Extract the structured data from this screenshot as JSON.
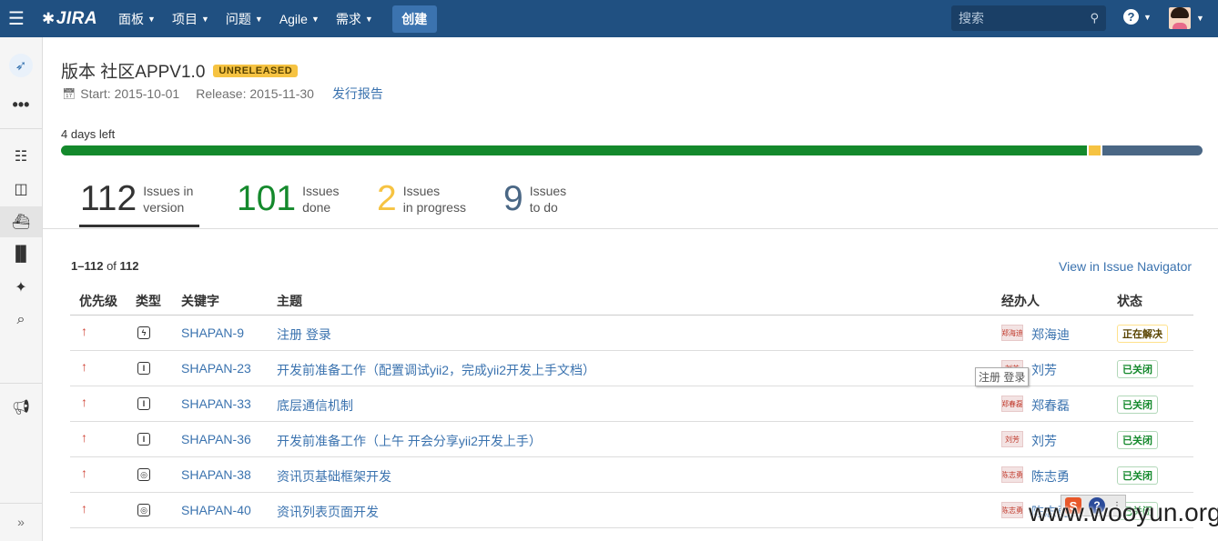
{
  "nav": {
    "logo": "JIRA",
    "items": [
      "面板",
      "项目",
      "问题",
      "Agile",
      "需求"
    ],
    "create_label": "创建",
    "search_placeholder": "搜索"
  },
  "version": {
    "title": "版本 社区APPV1.0",
    "badge": "UNRELEASED",
    "start": "Start: 2015-10-01",
    "release": "Release: 2015-11-30",
    "report_link": "发行报告",
    "days_left": "4 days left",
    "progress": {
      "done": 101,
      "in_progress": 2,
      "todo": 9,
      "total": 112,
      "colors": {
        "done": "#14892c",
        "in_progress": "#f6c342",
        "todo": "#4a6785"
      }
    }
  },
  "stats": [
    {
      "num": "112",
      "line1": "Issues in",
      "line2": "version",
      "color": "#333333"
    },
    {
      "num": "101",
      "line1": "Issues",
      "line2": "done",
      "color": "#14892c"
    },
    {
      "num": "2",
      "line1": "Issues",
      "line2": "in progress",
      "color": "#f6c342"
    },
    {
      "num": "9",
      "line1": "Issues",
      "line2": "to do",
      "color": "#4a6785"
    }
  ],
  "list": {
    "range": "1–112",
    "of": "of",
    "total": "112",
    "navigator_link": "View in Issue Navigator"
  },
  "table": {
    "headers": {
      "priority": "优先级",
      "type": "类型",
      "key": "关键字",
      "summary": "主题",
      "assignee": "经办人",
      "status": "状态"
    },
    "rows": [
      {
        "priority": "↑",
        "type_icon": "ϟ",
        "key": "SHAPAN-9",
        "summary": "注册 登录",
        "assignee_img": "郑海迪",
        "assignee": "郑海迪",
        "status": "正在解决",
        "status_kind": "inprog"
      },
      {
        "priority": "↑",
        "type_icon": "I",
        "key": "SHAPAN-23",
        "summary": "开发前准备工作（配置调试yii2，完成yii2开发上手文档）",
        "assignee_img": "刘芳",
        "assignee": "刘芳",
        "status": "已关闭",
        "status_kind": "closed"
      },
      {
        "priority": "↑",
        "type_icon": "I",
        "key": "SHAPAN-33",
        "summary": "底层通信机制",
        "assignee_img": "郑春磊",
        "assignee": "郑春磊",
        "status": "已关闭",
        "status_kind": "closed"
      },
      {
        "priority": "↑",
        "type_icon": "I",
        "key": "SHAPAN-36",
        "summary": "开发前准备工作（上午 开会分享yii2开发上手）",
        "assignee_img": "刘芳",
        "assignee": "刘芳",
        "status": "已关闭",
        "status_kind": "closed"
      },
      {
        "priority": "↑",
        "type_icon": "◎",
        "key": "SHAPAN-38",
        "summary": "资讯页基础框架开发",
        "assignee_img": "陈志勇",
        "assignee": "陈志勇",
        "status": "已关闭",
        "status_kind": "closed"
      },
      {
        "priority": "↑",
        "type_icon": "◎",
        "key": "SHAPAN-40",
        "summary": "资讯列表页面开发",
        "assignee_img": "陈志勇",
        "assignee": "陈志勇",
        "status": "已关闭",
        "status_kind": "closed"
      }
    ]
  },
  "tooltip": "注册 登录",
  "watermark": "www.wooyun.org",
  "sogou": {
    "s": "S",
    "q": "?"
  }
}
